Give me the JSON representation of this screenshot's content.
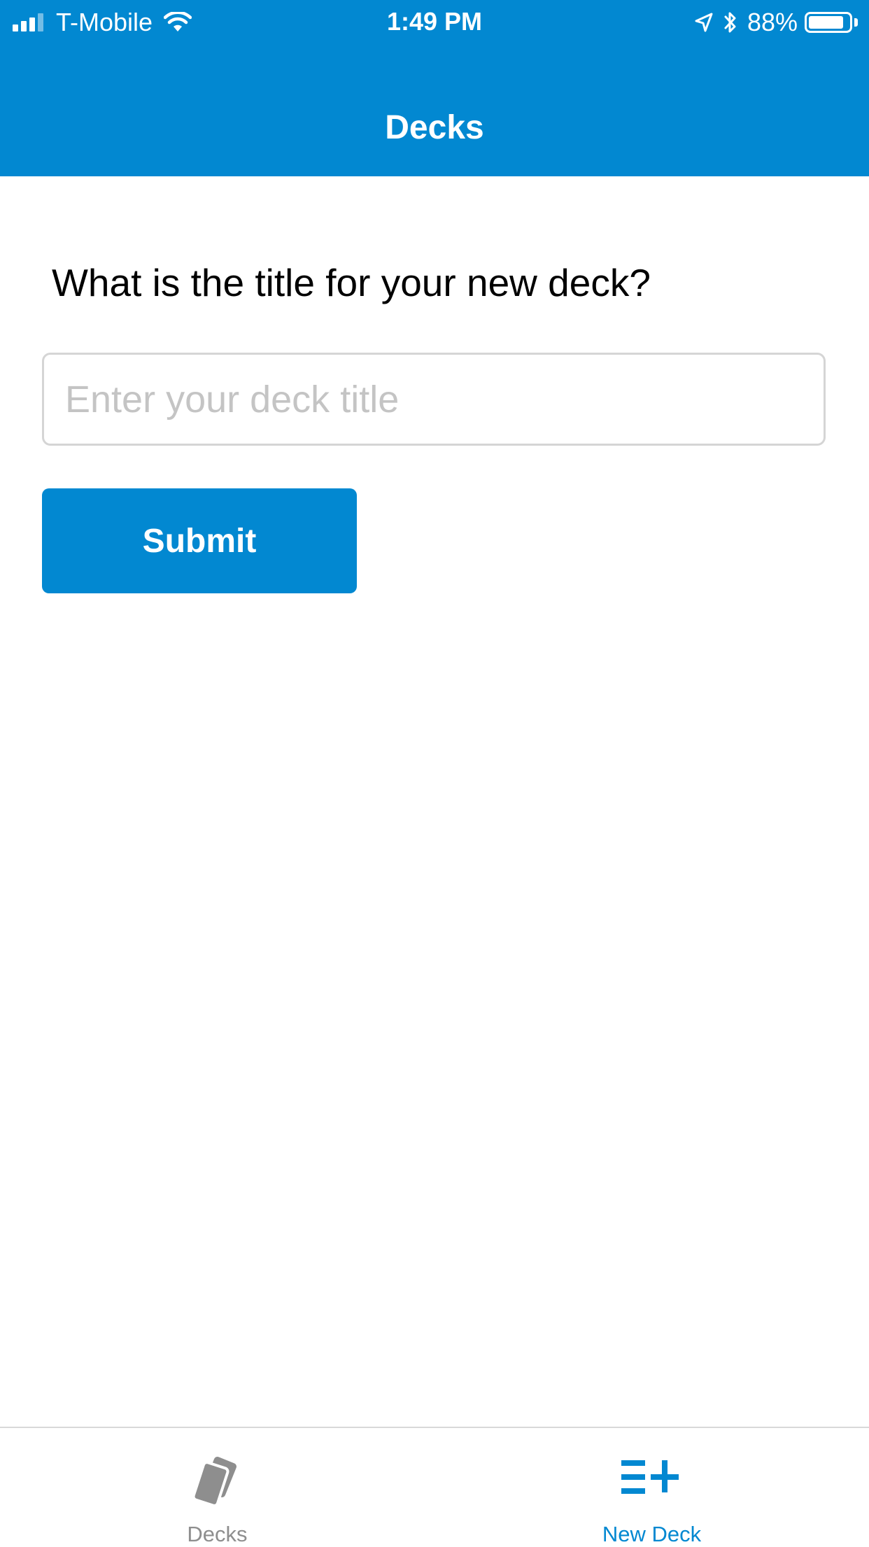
{
  "status_bar": {
    "carrier": "T-Mobile",
    "time": "1:49 PM",
    "battery": "88%",
    "battery_level": 0.88
  },
  "header": {
    "title": "Decks"
  },
  "form": {
    "question": "What is the title for your new deck?",
    "title_input": {
      "value": "",
      "placeholder": "Enter your deck title"
    },
    "submit_label": "Submit"
  },
  "tab_bar": {
    "tabs": [
      {
        "label": "Decks",
        "icon": "cards-icon",
        "active": false
      },
      {
        "label": "New Deck",
        "icon": "playlist-add-icon",
        "active": true
      }
    ]
  },
  "colors": {
    "primary": "#0288d1",
    "inactive_tab": "#8e8e8e",
    "input_border": "#d5d5d5",
    "placeholder": "#c4c4c4"
  }
}
